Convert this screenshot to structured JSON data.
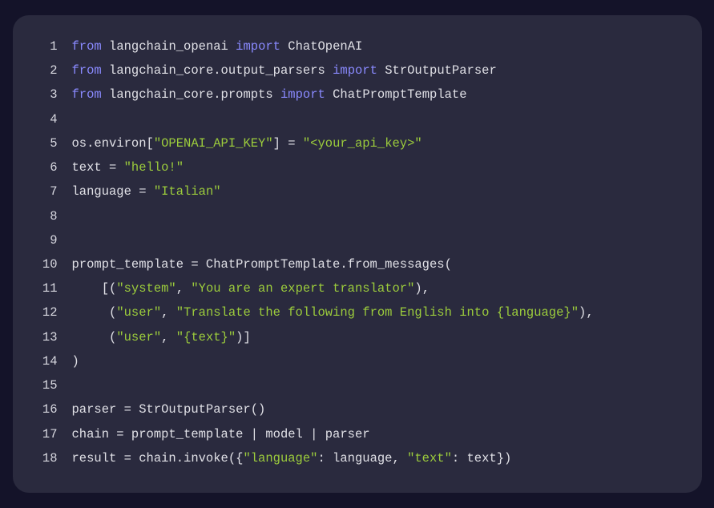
{
  "code": {
    "language": "python",
    "lines": [
      {
        "n": 1,
        "tokens": [
          {
            "t": "from",
            "c": "kw"
          },
          {
            "t": " ",
            "c": "id"
          },
          {
            "t": "langchain_openai",
            "c": "id"
          },
          {
            "t": " ",
            "c": "id"
          },
          {
            "t": "import",
            "c": "kw"
          },
          {
            "t": " ",
            "c": "id"
          },
          {
            "t": "ChatOpenAI",
            "c": "id"
          }
        ]
      },
      {
        "n": 2,
        "tokens": [
          {
            "t": "from",
            "c": "kw"
          },
          {
            "t": " ",
            "c": "id"
          },
          {
            "t": "langchain_core.output_parsers",
            "c": "id"
          },
          {
            "t": " ",
            "c": "id"
          },
          {
            "t": "import",
            "c": "kw"
          },
          {
            "t": " ",
            "c": "id"
          },
          {
            "t": "StrOutputParser",
            "c": "id"
          }
        ]
      },
      {
        "n": 3,
        "tokens": [
          {
            "t": "from",
            "c": "kw"
          },
          {
            "t": " ",
            "c": "id"
          },
          {
            "t": "langchain_core.prompts",
            "c": "id"
          },
          {
            "t": " ",
            "c": "id"
          },
          {
            "t": "import",
            "c": "kw"
          },
          {
            "t": " ",
            "c": "id"
          },
          {
            "t": "ChatPromptTemplate",
            "c": "id"
          }
        ]
      },
      {
        "n": 4,
        "tokens": []
      },
      {
        "n": 5,
        "tokens": [
          {
            "t": "os.environ[",
            "c": "id"
          },
          {
            "t": "\"OPENAI_API_KEY\"",
            "c": "str"
          },
          {
            "t": "] = ",
            "c": "id"
          },
          {
            "t": "\"<your_api_key>\"",
            "c": "str"
          }
        ]
      },
      {
        "n": 6,
        "tokens": [
          {
            "t": "text = ",
            "c": "id"
          },
          {
            "t": "\"hello!\"",
            "c": "str"
          }
        ]
      },
      {
        "n": 7,
        "tokens": [
          {
            "t": "language = ",
            "c": "id"
          },
          {
            "t": "\"Italian\"",
            "c": "str"
          }
        ]
      },
      {
        "n": 8,
        "tokens": []
      },
      {
        "n": 9,
        "tokens": []
      },
      {
        "n": 10,
        "tokens": [
          {
            "t": "prompt_template = ChatPromptTemplate.from_messages(",
            "c": "id"
          }
        ]
      },
      {
        "n": 11,
        "tokens": [
          {
            "t": "    [(",
            "c": "id"
          },
          {
            "t": "\"system\"",
            "c": "str"
          },
          {
            "t": ", ",
            "c": "id"
          },
          {
            "t": "\"You are an expert translator\"",
            "c": "str"
          },
          {
            "t": "),",
            "c": "id"
          }
        ]
      },
      {
        "n": 12,
        "tokens": [
          {
            "t": "     (",
            "c": "id"
          },
          {
            "t": "\"user\"",
            "c": "str"
          },
          {
            "t": ", ",
            "c": "id"
          },
          {
            "t": "\"Translate the following from English into {language}\"",
            "c": "str"
          },
          {
            "t": "),",
            "c": "id"
          }
        ]
      },
      {
        "n": 13,
        "tokens": [
          {
            "t": "     (",
            "c": "id"
          },
          {
            "t": "\"user\"",
            "c": "str"
          },
          {
            "t": ", ",
            "c": "id"
          },
          {
            "t": "\"{text}\"",
            "c": "str"
          },
          {
            "t": ")]",
            "c": "id"
          }
        ]
      },
      {
        "n": 14,
        "tokens": [
          {
            "t": ")",
            "c": "id"
          }
        ]
      },
      {
        "n": 15,
        "tokens": []
      },
      {
        "n": 16,
        "tokens": [
          {
            "t": "parser = StrOutputParser()",
            "c": "id"
          }
        ]
      },
      {
        "n": 17,
        "tokens": [
          {
            "t": "chain = prompt_template | model | parser",
            "c": "id"
          }
        ]
      },
      {
        "n": 18,
        "tokens": [
          {
            "t": "result = chain.invoke({",
            "c": "id"
          },
          {
            "t": "\"language\"",
            "c": "str"
          },
          {
            "t": ": language, ",
            "c": "id"
          },
          {
            "t": "\"text\"",
            "c": "str"
          },
          {
            "t": ": text})",
            "c": "id"
          }
        ]
      }
    ]
  }
}
